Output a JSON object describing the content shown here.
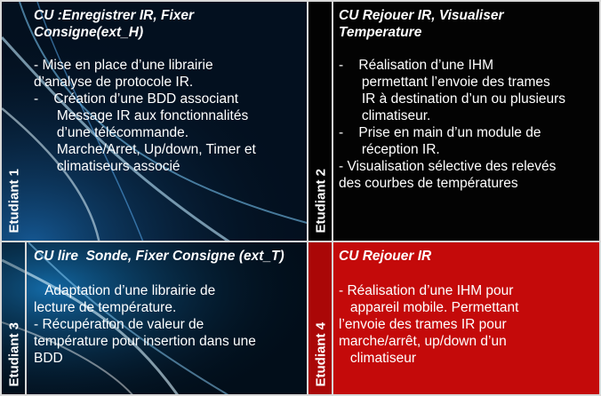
{
  "cells": [
    {
      "student": "Etudiant 1",
      "title_lines": [
        "CU :Enregistrer IR, Fixer",
        "Consigne(ext_H)"
      ],
      "lines": [
        "- Mise en place d’une librairie",
        "d’analyse de protocole IR.",
        "-    Création d’une BDD associant",
        "      Message IR aux fonctionnalités",
        "      d’une télécommande.",
        "      Marche/Arret, Up/down, Timer et",
        "      climatiseurs associé"
      ]
    },
    {
      "student": "Etudiant 2",
      "title_lines": [
        "CU Rejouer IR, Visualiser",
        "Temperature"
      ],
      "lines": [
        "-    Réalisation d’une IHM",
        "      permettant l’envoie des trames",
        "      IR à destination d’un ou plusieurs",
        "      climatiseur.",
        "-    Prise en main d’un module de",
        "      réception IR.",
        "- Visualisation sélective des relevés",
        "des courbes de températures"
      ]
    },
    {
      "student": "Etudiant 3",
      "title_lines": [
        "CU lire  Sonde, Fixer Consigne (ext_T)"
      ],
      "lines": [
        "   Adaptation d’une librairie de",
        "lecture de température.",
        "- Récupération de valeur de",
        "température pour insertion dans une",
        "BDD"
      ]
    },
    {
      "student": "Etudiant 4",
      "title_lines": [
        "CU Rejouer IR"
      ],
      "lines": [
        "- Réalisation d’une IHM pour",
        "   appareil mobile. Permettant",
        "l’envoie des trames IR pour",
        "marche/arrêt, up/down d’un",
        "   climatiseur"
      ]
    }
  ],
  "colors": {
    "cell4_background": "#c40a0a",
    "border": "#d8d8d8"
  }
}
